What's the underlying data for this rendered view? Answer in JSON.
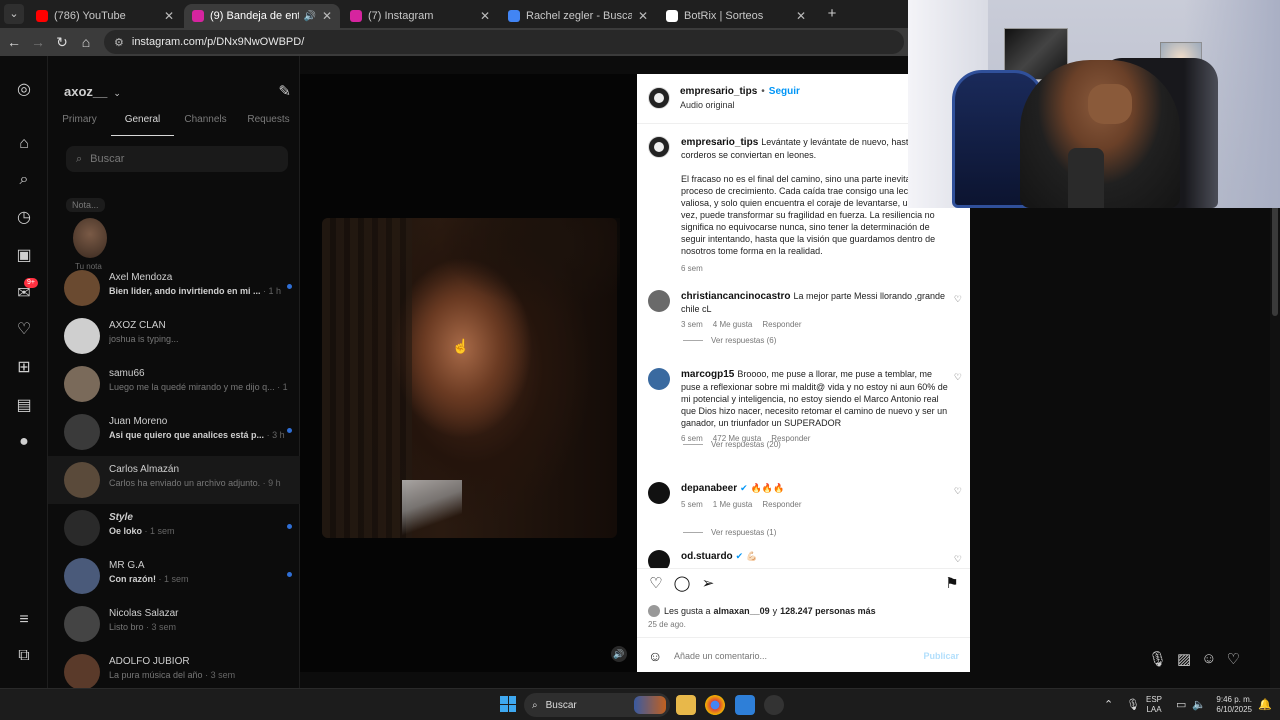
{
  "browser": {
    "tabs": [
      {
        "title": "(786) YouTube",
        "favicon_color": "#ff0000"
      },
      {
        "title": "(9) Bandeja de entrada • Chats",
        "favicon_color": "#d6249f"
      },
      {
        "title": "(7) Instagram",
        "favicon_color": "#d6249f"
      },
      {
        "title": "Rachel zegler - Buscar con Google",
        "favicon_color": "#4285f4"
      },
      {
        "title": "BotRix | Sorteos",
        "favicon_color": "#ffffff"
      }
    ],
    "url": "instagram.com/p/DNx9NwOWBPD/"
  },
  "dm": {
    "username": "axoz__",
    "tabs": [
      "Primary",
      "General",
      "Channels",
      "Requests"
    ],
    "search_placeholder": "Buscar",
    "note_bubble": "Nota...",
    "note_label": "Tu nota",
    "conversations": [
      {
        "name": "Axel Mendoza",
        "preview": "Bien lider, ando invirtiendo en mi ...",
        "time": "· 1 h",
        "bold": true,
        "unread": true,
        "color": "#6a4a30"
      },
      {
        "name": "AXOZ CLAN",
        "preview": "joshua is typing...",
        "time": "",
        "bold": false,
        "unread": false,
        "color": "#cfcfcf"
      },
      {
        "name": "samu66",
        "preview": "Luego me la quedé mirando y me dijo q...",
        "time": "· 1 h",
        "bold": false,
        "unread": false,
        "color": "#7a6a5a"
      },
      {
        "name": "Juan Moreno",
        "preview": "Asi que quiero que analices está p...",
        "time": "· 3 h",
        "bold": true,
        "unread": true,
        "color": "#3a3a3a"
      },
      {
        "name": "Carlos Almazán",
        "preview": "Carlos ha enviado un archivo adjunto.",
        "time": "· 9 h",
        "bold": false,
        "unread": false,
        "color": "#5a4a3a"
      },
      {
        "name": "Style",
        "preview": "Oe loko",
        "time": "· 1 sem",
        "bold": true,
        "unread": true,
        "color": "#2a2a2a"
      },
      {
        "name": "MR G.A",
        "preview": "Con razón!",
        "time": "· 1 sem",
        "bold": true,
        "unread": true,
        "color": "#4a5a7a"
      },
      {
        "name": "Nicolas Salazar",
        "preview": "Listo bro",
        "time": "· 3 sem",
        "bold": false,
        "unread": false,
        "color": "#444444"
      },
      {
        "name": "ADOLFO JUBIOR",
        "preview": "La pura música del año",
        "time": "· 3 sem",
        "bold": false,
        "unread": false,
        "color": "#5a3a2a"
      }
    ]
  },
  "post": {
    "author": "empresario_tips",
    "follow": "Seguir",
    "audio": "Audio original",
    "caption_p1": "Levántate y levántate de nuevo, hasta que los corderos se conviertan en leones.",
    "caption_p2": "El fracaso no es el final del camino, sino una parte inevitable del proceso de crecimiento. Cada caída trae consigo una lección valiosa, y solo quien encuentra el coraje de levantarse, una y otra vez, puede transformar su fragilidad en fuerza. La resiliencia no significa no equivocarse nunca, sino tener la determinación de seguir intentando, hasta que la visión que guardamos dentro de nosotros tome forma en la realidad.",
    "caption_time": "6 sem",
    "comments": [
      {
        "user": "christiancancinocastro",
        "verified": false,
        "text": "La mejor parte Messi llorando ,grande chile cL",
        "time": "3 sem",
        "likes": "4 Me gusta",
        "reply": "Responder",
        "replies": "Ver respuestas (6)",
        "avatar_color": "#6a6a6a"
      },
      {
        "user": "marcogp15",
        "verified": false,
        "text": "Broooo, me puse a llorar, me puse a temblar, me puse a reflexionar sobre mi maldit@ vida y no estoy ni aun 60% de mi potencial y inteligencia, no estoy siendo el Marco Antonio real que Dios hizo nacer, necesito retomar el camino de nuevo y ser un ganador, un triunfador un SUPERADOR",
        "time": "6 sem",
        "likes": "472 Me gusta",
        "reply": "Responder",
        "replies": "Ver respuestas (20)",
        "avatar_color": "#3a6aa0"
      },
      {
        "user": "depanabeer",
        "verified": true,
        "text": "🔥🔥🔥",
        "time": "5 sem",
        "likes": "1 Me gusta",
        "reply": "Responder",
        "replies": "Ver respuestas (1)",
        "avatar_color": "#111111"
      },
      {
        "user": "od.stuardo",
        "verified": true,
        "text": "💪🏻",
        "time": "",
        "likes": "",
        "reply": "",
        "replies": "",
        "avatar_color": "#111111"
      }
    ],
    "likes_prefix": "Les gusta a",
    "likes_user": "almaxan__09",
    "likes_join": "y",
    "likes_count": "128.247 personas más",
    "date": "25 de ago.",
    "comment_placeholder": "Añade un comentario...",
    "publish": "Publicar"
  },
  "taskbar": {
    "search": "Buscar",
    "lang1": "ESP",
    "lang2": "LAA",
    "time": "9:46 p. m.",
    "date": "6/10/2025"
  }
}
